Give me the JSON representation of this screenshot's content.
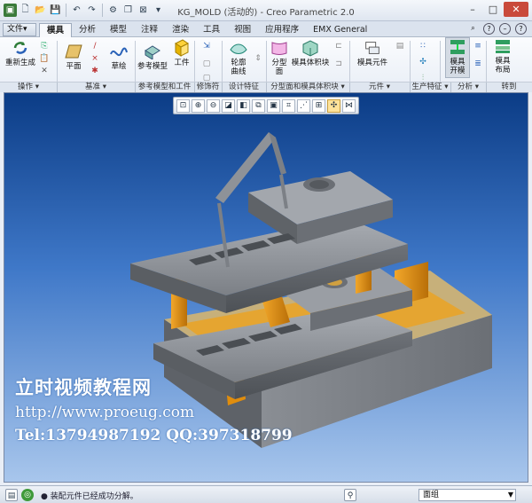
{
  "window": {
    "title": "KG_MOLD (活动的) - Creo Parametric 2.0"
  },
  "tabs": {
    "file": "文件▾",
    "items": [
      "模具",
      "分析",
      "模型",
      "注释",
      "渲染",
      "工具",
      "视图",
      "应用程序",
      "EMX General"
    ]
  },
  "ribbon": {
    "regenerate": "重新生成",
    "plane": "平面",
    "sketch": "草绘",
    "ref_model": "参考模型",
    "workpiece": "工件",
    "silhouette": "轮廓\n曲线",
    "parting_surface": "分型\n面",
    "mold_volume": "模具体积块",
    "mold_component": "模具元件",
    "mold_open": "模具\n开模",
    "mold_layout": "模具\n布局"
  },
  "groups": {
    "operations": "操作 ▾",
    "datum": "基准 ▾",
    "ref_model_workpiece": "参考模型和工件",
    "modifiers": "修饰符",
    "design_features": "设计特征",
    "parting": "分型面和模具体积块 ▾",
    "components": "元件 ▾",
    "production": "生产特征 ▾",
    "analysis": "分析 ▾",
    "goto": "转到"
  },
  "watermark": {
    "line1": "立时视频教程网",
    "line2": "http://www.proeug.com",
    "line3": "Tel:13794987192  QQ:397318799"
  },
  "status": {
    "message": "● 装配元件已经成功分解。",
    "filter": "面组"
  },
  "colors": {
    "viewport_top": "#0b3c86",
    "viewport_bottom": "#a8c6ec",
    "part_gray": "#8d9196",
    "support_orange": "#e29416",
    "base_gray": "#7b7f85"
  }
}
